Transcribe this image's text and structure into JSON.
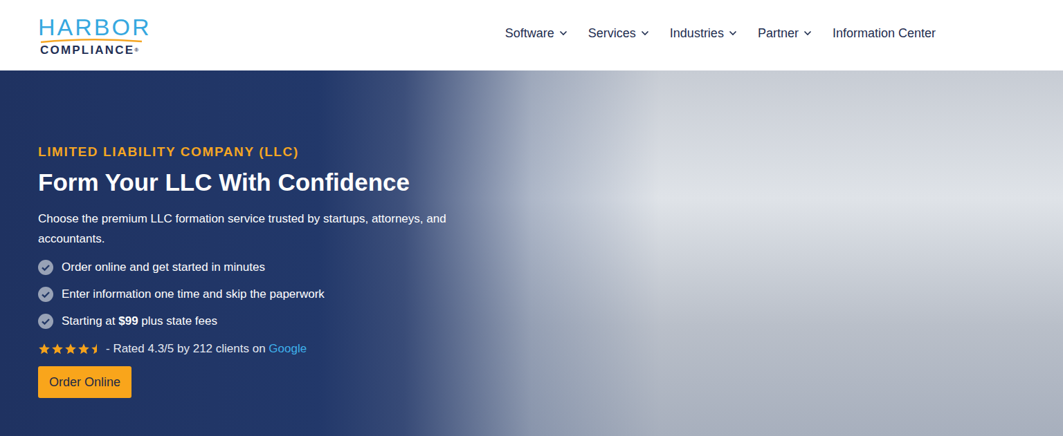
{
  "logo": {
    "name": "HARBOR",
    "sub": "COMPLIANCE",
    "mark": "®"
  },
  "nav": [
    {
      "label": "Software",
      "dropdown": true
    },
    {
      "label": "Services",
      "dropdown": true
    },
    {
      "label": "Industries",
      "dropdown": true
    },
    {
      "label": "Partner",
      "dropdown": true
    },
    {
      "label": "Information Center",
      "dropdown": false
    }
  ],
  "hero": {
    "eyebrow": "LIMITED LIABILITY COMPANY (LLC)",
    "title": "Form Your LLC With Confidence",
    "subtitle": "Choose the premium LLC formation service trusted by startups, attorneys, and accountants.",
    "features": [
      {
        "parts": [
          {
            "text": "Order online and get started in minutes",
            "bold": false
          }
        ]
      },
      {
        "parts": [
          {
            "text": "Enter information one time and skip the paperwork",
            "bold": false
          }
        ]
      },
      {
        "parts": [
          {
            "text": "Starting at ",
            "bold": false
          },
          {
            "text": "$99",
            "bold": true
          },
          {
            "text": " plus state fees",
            "bold": false
          }
        ]
      }
    ],
    "rating": {
      "stars": 4.5,
      "text": "- Rated 4.3/5 by 212 clients on ",
      "link": "Google"
    },
    "button": "Order Online"
  }
}
